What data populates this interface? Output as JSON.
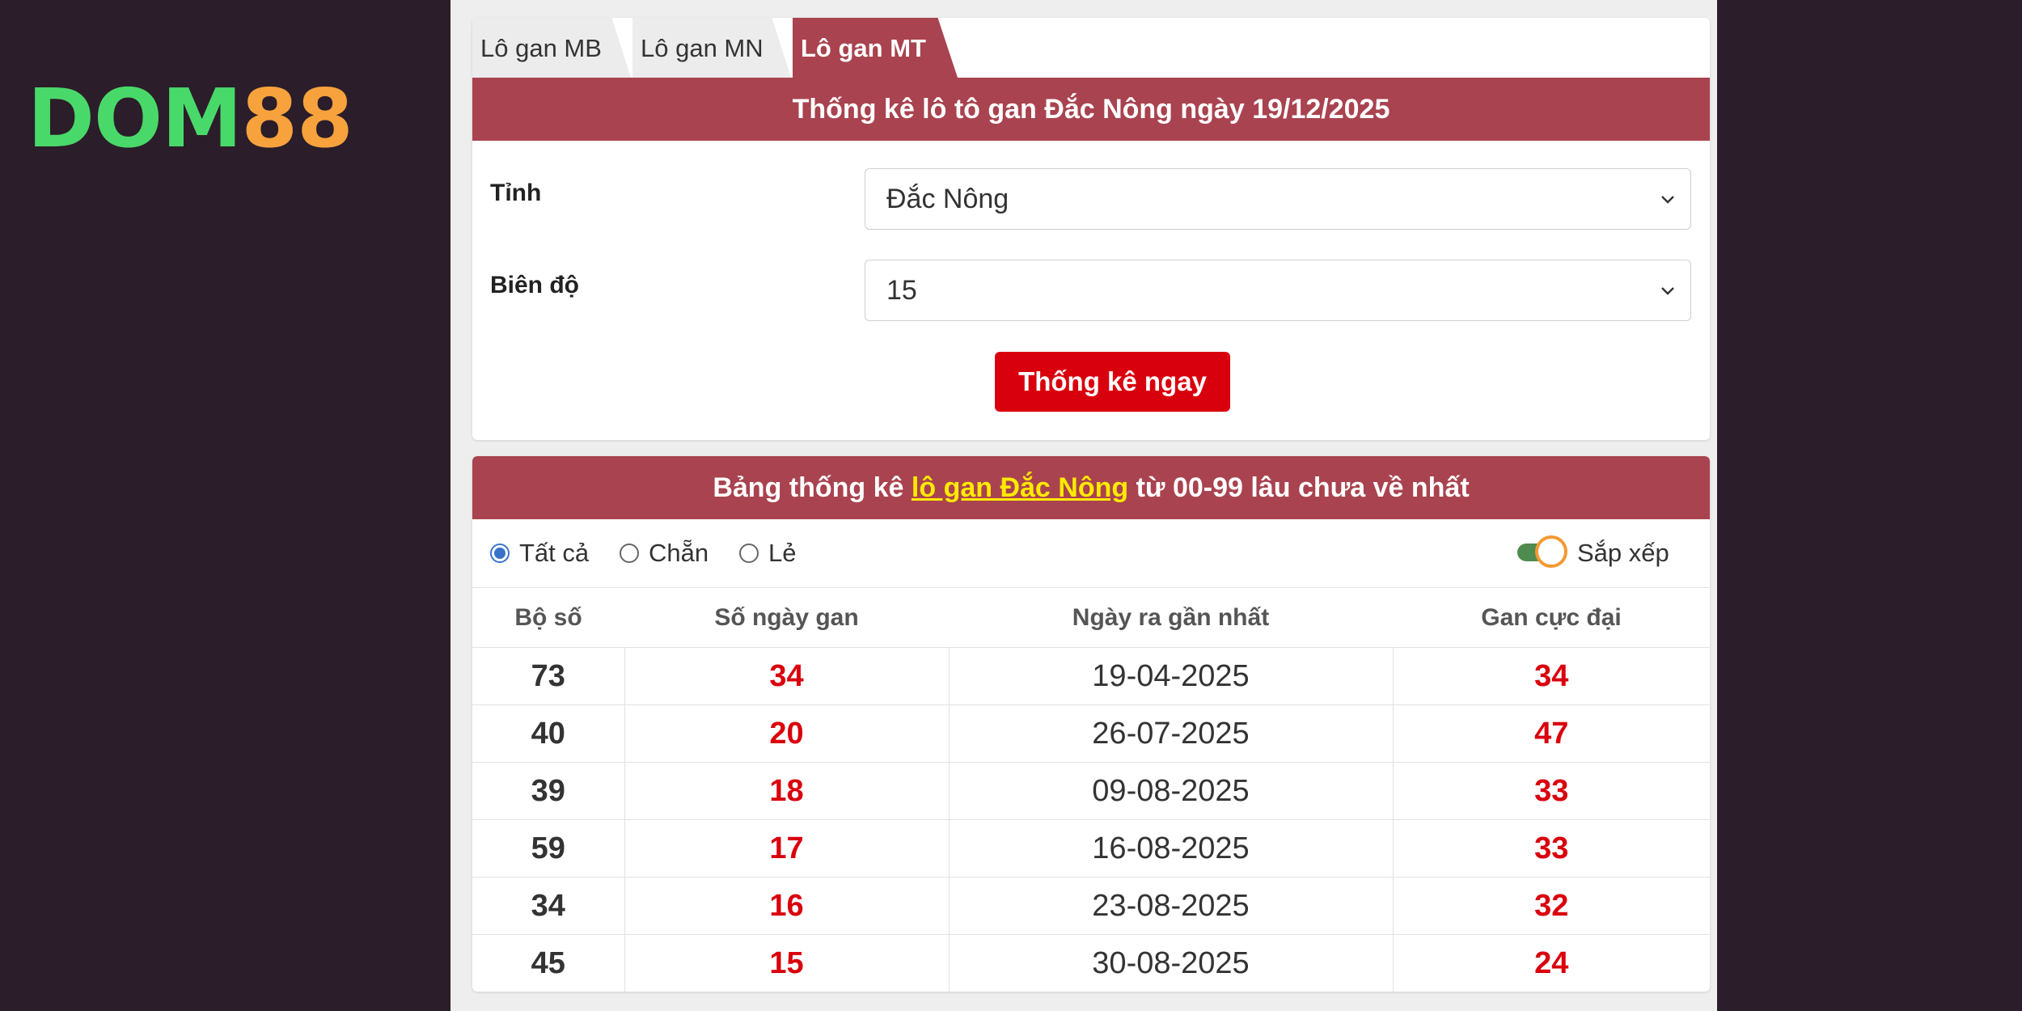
{
  "logo": {
    "part1": "DOM",
    "part2": "88"
  },
  "tabs": [
    {
      "label": "Lô gan MB",
      "active": false
    },
    {
      "label": "Lô gan MN",
      "active": false
    },
    {
      "label": "Lô gan MT",
      "active": true
    }
  ],
  "form": {
    "title": "Thống kê lô tô gan Đắc Nông ngày 19/12/2025",
    "province_label": "Tỉnh",
    "province_value": "Đắc Nông",
    "range_label": "Biên độ",
    "range_value": "15",
    "submit_label": "Thống kê ngay"
  },
  "results": {
    "title_prefix": "Bảng thống kê",
    "title_link": "lô gan Đắc Nông",
    "title_suffix": "từ 00-99 lâu chưa về nhất",
    "filters": {
      "all_label": "Tất cả",
      "even_label": "Chẵn",
      "odd_label": "Lẻ",
      "selected": "Tất cả",
      "sort_label": "Sắp xếp"
    },
    "columns": [
      "Bộ số",
      "Số ngày gan",
      "Ngày ra gần nhất",
      "Gan cực đại"
    ],
    "rows": [
      {
        "number": "73",
        "days": "34",
        "last_date": "19-04-2025",
        "max": "34"
      },
      {
        "number": "40",
        "days": "20",
        "last_date": "26-07-2025",
        "max": "47"
      },
      {
        "number": "39",
        "days": "18",
        "last_date": "09-08-2025",
        "max": "33"
      },
      {
        "number": "59",
        "days": "17",
        "last_date": "16-08-2025",
        "max": "33"
      },
      {
        "number": "34",
        "days": "16",
        "last_date": "23-08-2025",
        "max": "32"
      },
      {
        "number": "45",
        "days": "15",
        "last_date": "30-08-2025",
        "max": "24"
      }
    ]
  },
  "colors": {
    "background": "#2b1d29",
    "banner": "#a9434f",
    "button": "#d9000d",
    "highlight": "#ffea00",
    "logo_green": "#49d96a",
    "logo_orange": "#f7a23c"
  }
}
